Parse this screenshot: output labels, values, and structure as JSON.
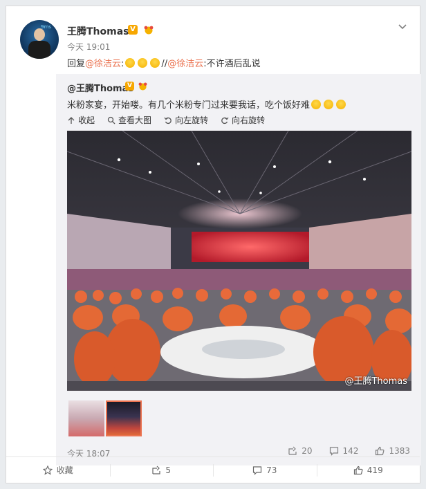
{
  "post": {
    "username": "王腾Thomas",
    "verified_badge": "V",
    "avatar_tag": "9ms",
    "time": "今天 19:01",
    "reply_prefix": "回复",
    "mention1": "@徐洁云",
    "sep": "//",
    "mention2": "@徐洁云",
    "reply_text": ":不许酒后乱说"
  },
  "quoted": {
    "username": "@王腾Thomas",
    "verified_badge": "V",
    "text": "米粉家宴，开始喽。有几个米粉专门过来要我话，吃个饭好难",
    "tools": {
      "collapse": "收起",
      "view_large": "查看大图",
      "rotate_left": "向左旋转",
      "rotate_right": "向右旋转"
    },
    "watermark": "@王腾Thomas",
    "time": "今天 18:07",
    "stats": {
      "forward": "20",
      "comment": "142",
      "like": "1383"
    }
  },
  "actions": {
    "favorite": "收藏",
    "forward": "5",
    "comment": "73",
    "like": "419"
  },
  "colors": {
    "accent": "#eb7350",
    "vip": "#f7a700"
  }
}
